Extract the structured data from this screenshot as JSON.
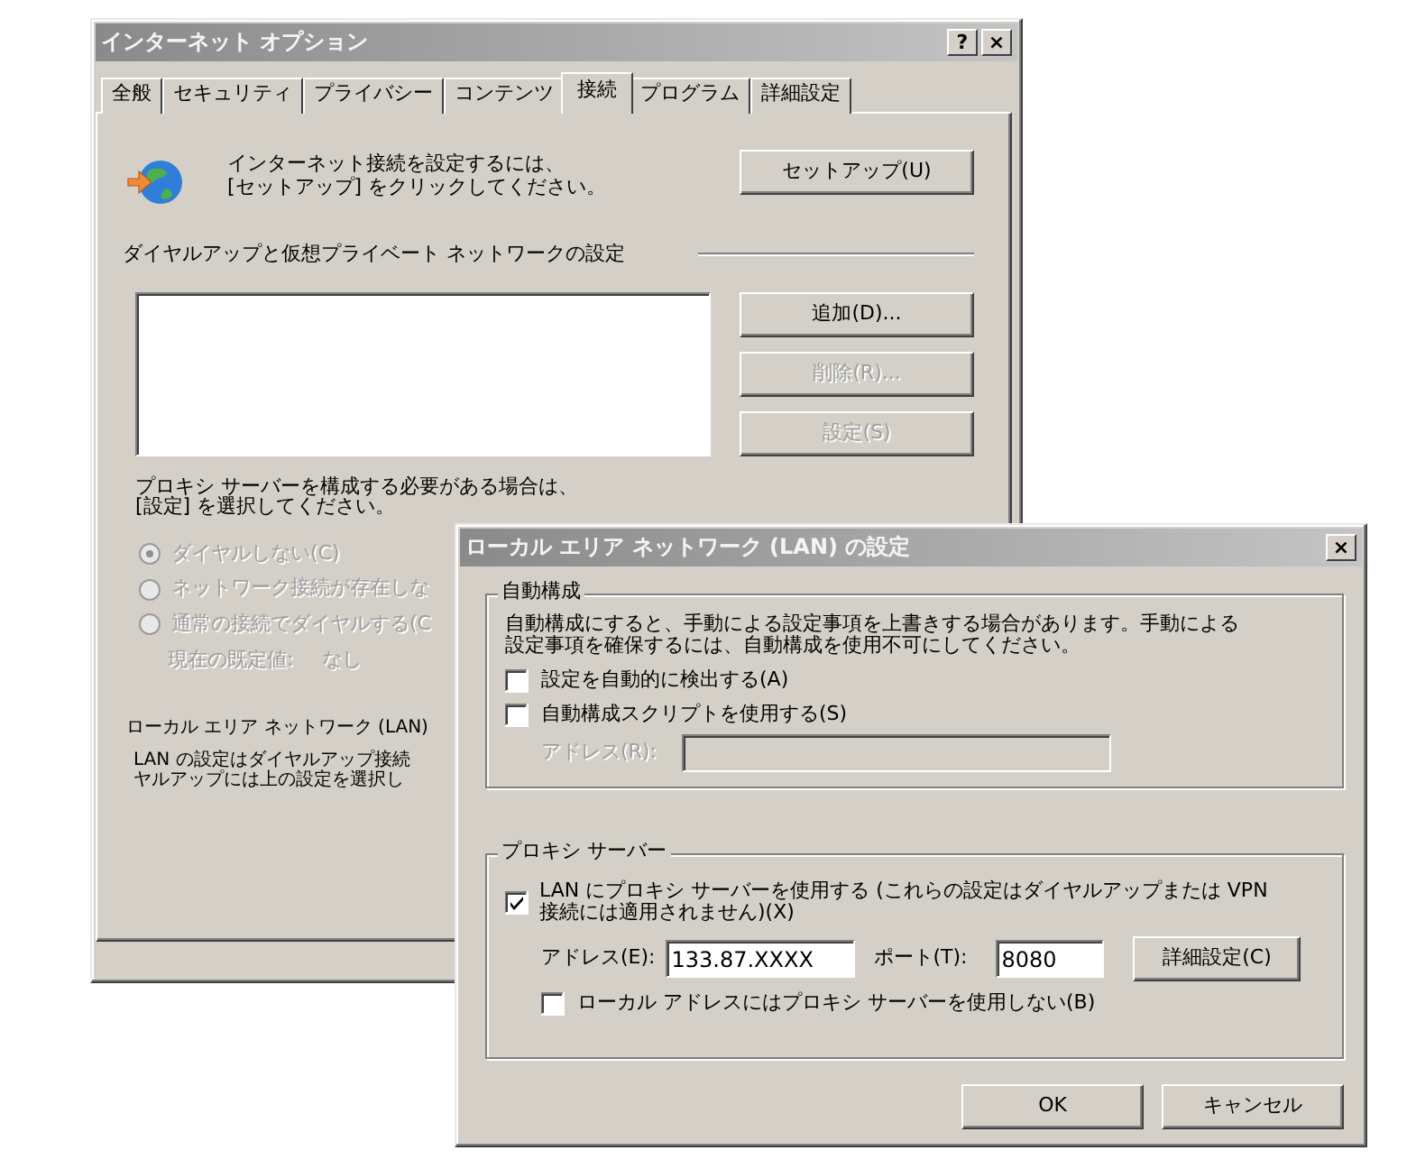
{
  "options_window": {
    "title": "インターネット オプション",
    "help_button": "?",
    "close_button": "×",
    "tabs": [
      {
        "label": "全般",
        "selected": false
      },
      {
        "label": "セキュリティ",
        "selected": false
      },
      {
        "label": "プライバシー",
        "selected": false
      },
      {
        "label": "コンテンツ",
        "selected": false
      },
      {
        "label": "接続",
        "selected": true
      },
      {
        "label": "プログラム",
        "selected": false
      },
      {
        "label": "詳細設定",
        "selected": false
      }
    ],
    "setup": {
      "text": "インターネット接続を設定するには、\n[セットアップ] をクリックしてください。",
      "button": "セットアップ(U)"
    },
    "dialup": {
      "heading": "ダイヤルアップと仮想プライベート ネットワークの設定",
      "buttons": [
        {
          "label": "追加(D)...",
          "disabled": false
        },
        {
          "label": "削除(R)...",
          "disabled": true
        },
        {
          "label": "設定(S)",
          "disabled": true
        }
      ]
    },
    "proxy_note": "プロキシ サーバーを構成する必要がある場合は、\n[設定] を選択してください。",
    "dial_options": [
      {
        "label": "ダイヤルしない(C)",
        "selected": true,
        "disabled": true
      },
      {
        "label": "ネットワーク接続が存在しな",
        "selected": false,
        "disabled": true
      },
      {
        "label": "通常の接続でダイヤルする(C",
        "selected": false,
        "disabled": true
      }
    ],
    "current_default": {
      "label": "現在の既定値:",
      "value": "なし"
    },
    "lan": {
      "heading": "ローカル エリア ネットワーク (LAN)",
      "lines": [
        "LAN の設定はダイヤルアップ接続",
        "ヤルアップには上の設定を選択し"
      ]
    }
  },
  "lan_dialog": {
    "title": "ローカル エリア ネットワーク (LAN) の設定",
    "close_button": "×",
    "auto_config": {
      "legend": "自動構成",
      "description_lines": [
        "自動構成にすると、手動による設定事項を上書きする場合があります。手動による",
        "設定事項を確保するには、自動構成を使用不可にしてください。"
      ],
      "options": [
        {
          "label": "設定を自動的に検出する(A)",
          "checked": false
        },
        {
          "label": "自動構成スクリプトを使用する(S)",
          "checked": false
        }
      ],
      "address": {
        "label": "アドレス(R):",
        "disabled": true
      }
    },
    "proxy": {
      "legend": "プロキシ サーバー",
      "use_proxy": {
        "label_lines": [
          "LAN にプロキシ サーバーを使用する (これらの設定はダイヤルアップまたは VPN",
          "接続には適用されません)(X)"
        ],
        "checked": true
      },
      "address": {
        "label": "アドレス(E):",
        "value": "133.87.XXXX"
      },
      "port": {
        "label": "ポート(T):",
        "value": "8080"
      },
      "advanced_button": "詳細設定(C)",
      "bypass_local": {
        "label": "ローカル アドレスにはプロキシ サーバーを使用しない(B)",
        "checked": false
      }
    },
    "buttons": [
      "OK",
      "キャンセル"
    ]
  }
}
